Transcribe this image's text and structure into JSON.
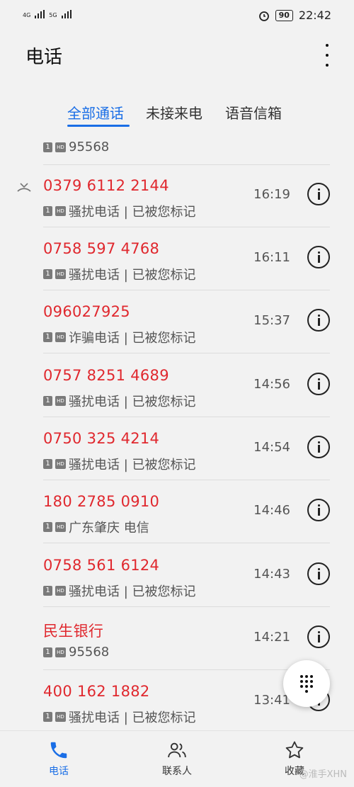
{
  "status": {
    "signal_left": "4G",
    "signal_right": "5G",
    "battery": "90",
    "time": "22:42"
  },
  "app": {
    "title": "电话"
  },
  "tabs": [
    {
      "label": "全部通话",
      "active": true
    },
    {
      "label": "未接来电",
      "active": false
    },
    {
      "label": "语音信箱",
      "active": false
    }
  ],
  "calls": [
    {
      "name": "",
      "sim": "1",
      "hd": "HD",
      "detail": "95568",
      "time": ""
    },
    {
      "name": "0379 6112 2144",
      "sim": "1",
      "hd": "HD",
      "detail": "骚扰电话 | 已被您标记",
      "time": "16:19"
    },
    {
      "name": "0758 597 4768",
      "sim": "1",
      "hd": "HD",
      "detail": "骚扰电话 | 已被您标记",
      "time": "16:11"
    },
    {
      "name": "096027925",
      "sim": "1",
      "hd": "HD",
      "detail": "诈骗电话 | 已被您标记",
      "time": "15:37"
    },
    {
      "name": "0757 8251 4689",
      "sim": "1",
      "hd": "HD",
      "detail": "骚扰电话 | 已被您标记",
      "time": "14:56"
    },
    {
      "name": "0750 325 4214",
      "sim": "1",
      "hd": "HD",
      "detail": "骚扰电话 | 已被您标记",
      "time": "14:54"
    },
    {
      "name": "180 2785 0910",
      "sim": "1",
      "hd": "HD",
      "detail": "广东肇庆 电信",
      "time": "14:46"
    },
    {
      "name": "0758 561 6124",
      "sim": "1",
      "hd": "HD",
      "detail": "骚扰电话 | 已被您标记",
      "time": "14:43"
    },
    {
      "name": "民生银行",
      "sim": "1",
      "hd": "HD",
      "detail": "95568",
      "time": "14:21"
    },
    {
      "name": "400 162 1882",
      "sim": "1",
      "hd": "HD",
      "detail": "骚扰电话 | 已被您标记",
      "time": "13:41"
    }
  ],
  "nav": [
    {
      "label": "电话",
      "icon": "phone-icon",
      "active": true
    },
    {
      "label": "联系人",
      "icon": "contacts-icon",
      "active": false
    },
    {
      "label": "收藏",
      "icon": "star-icon",
      "active": false
    }
  ],
  "watermark": "@淮手XHN",
  "colors": {
    "accent": "#1a6ee6",
    "missed": "#e0282e"
  }
}
